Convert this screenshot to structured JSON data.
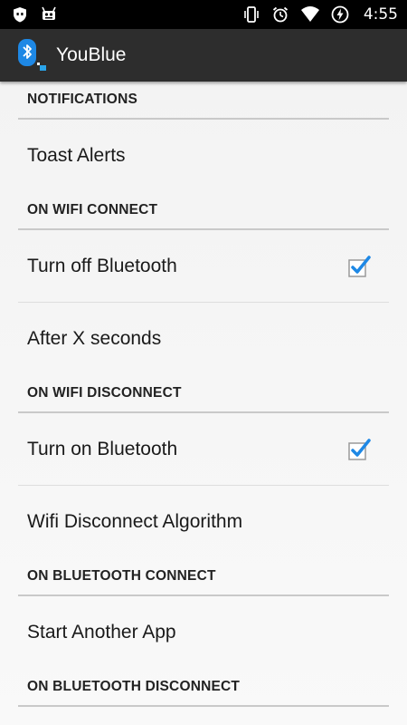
{
  "status_bar": {
    "time": "4:55",
    "left_icons": [
      "shield-icon",
      "android-icon"
    ],
    "right_icons": [
      "vibrate-icon",
      "alarm-icon",
      "wifi-icon",
      "battery-charging-icon"
    ]
  },
  "app": {
    "title": "YouBlue",
    "icon": "bluetooth-app-icon",
    "accent_color": "#1e88e5"
  },
  "sections": [
    {
      "header": "NOTIFICATIONS",
      "items": [
        {
          "label": "Toast Alerts",
          "has_checkbox": false
        }
      ]
    },
    {
      "header": "ON WIFI CONNECT",
      "items": [
        {
          "label": "Turn off Bluetooth",
          "has_checkbox": true,
          "checked": true
        },
        {
          "label": "After X seconds",
          "has_checkbox": false
        }
      ]
    },
    {
      "header": "ON WIFI DISCONNECT",
      "items": [
        {
          "label": "Turn on Bluetooth",
          "has_checkbox": true,
          "checked": true
        },
        {
          "label": "Wifi Disconnect Algorithm",
          "has_checkbox": false
        }
      ]
    },
    {
      "header": "ON BLUETOOTH CONNECT",
      "items": [
        {
          "label": "Start Another App",
          "has_checkbox": false
        }
      ]
    },
    {
      "header": "ON BLUETOOTH DISCONNECT",
      "items": []
    }
  ]
}
